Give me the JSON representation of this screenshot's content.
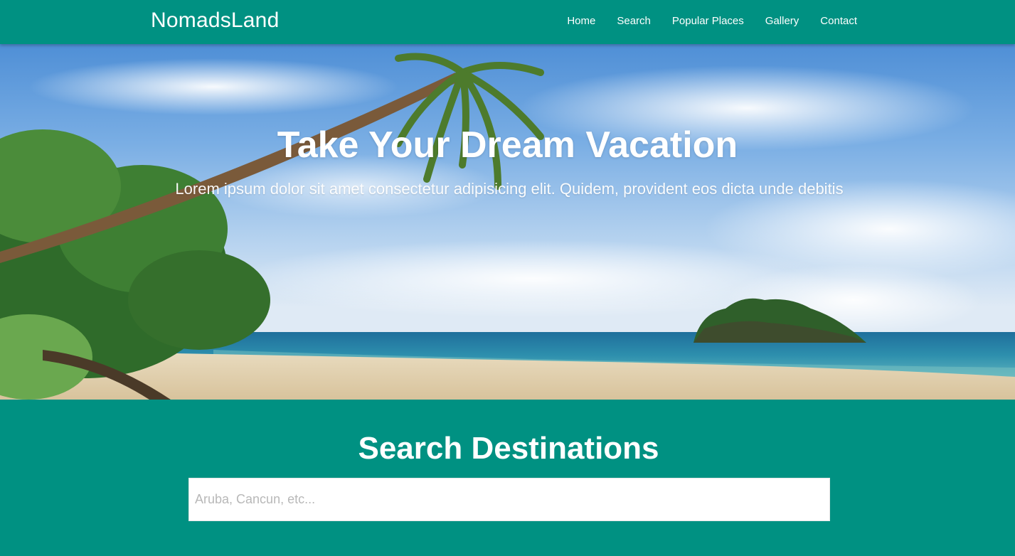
{
  "navbar": {
    "brand": "NomadsLand",
    "links": [
      {
        "label": "Home"
      },
      {
        "label": "Search"
      },
      {
        "label": "Popular Places"
      },
      {
        "label": "Gallery"
      },
      {
        "label": "Contact"
      }
    ]
  },
  "hero": {
    "title": "Take Your Dream Vacation",
    "subtitle": "Lorem ipsum dolor sit amet consectetur adipisicing elit. Quidem, provident eos dicta unde debitis"
  },
  "search": {
    "title": "Search Destinations",
    "placeholder": "Aruba, Cancun, etc...",
    "value": ""
  },
  "colors": {
    "primary": "#009182",
    "text_light": "#ffffff"
  }
}
